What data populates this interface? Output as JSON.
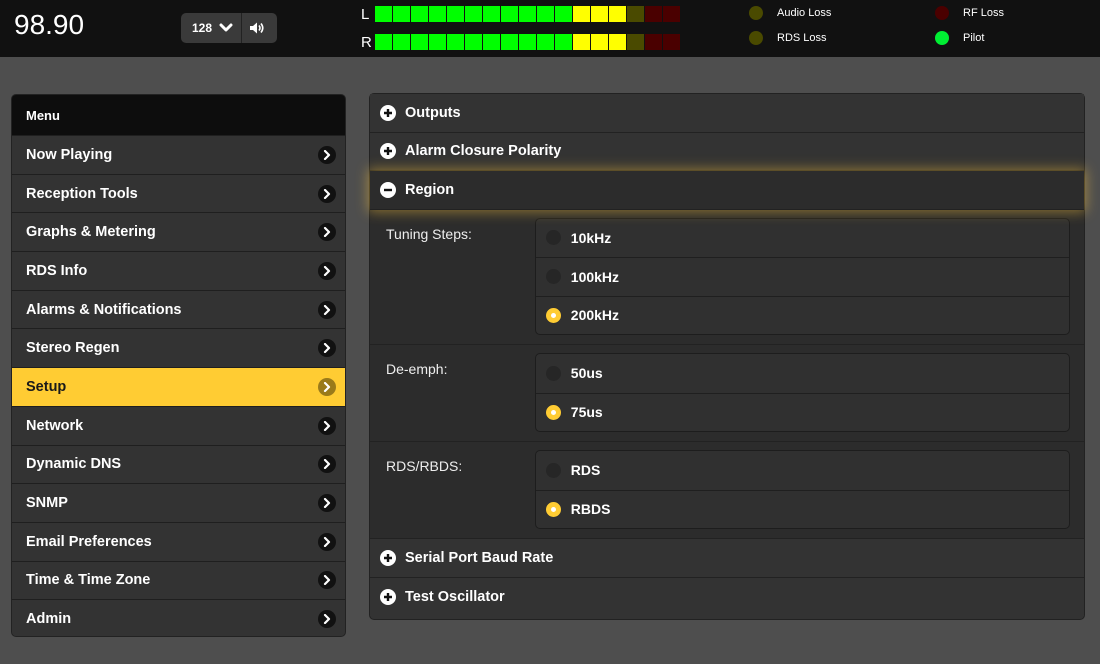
{
  "header": {
    "frequency": "98.90",
    "volume_value": "128"
  },
  "meters": {
    "left": {
      "label": "L",
      "level": 0.625,
      "segments": [
        "#00ff00",
        "#00ff00",
        "#00ff00",
        "#00ff00",
        "#00ff00",
        "#00ff00",
        "#00ff00",
        "#00ff00",
        "#00ff00",
        "#00ff00",
        "#00ff00",
        "#ffff00",
        "#ffff00",
        "#ffff00",
        "#4a4a00",
        "#4a0000",
        "#4a0000"
      ]
    },
    "right": {
      "label": "R",
      "level": 0.625,
      "segments": [
        "#00ff00",
        "#00ff00",
        "#00ff00",
        "#00ff00",
        "#00ff00",
        "#00ff00",
        "#00ff00",
        "#00ff00",
        "#00ff00",
        "#00ff00",
        "#00ff00",
        "#ffff00",
        "#ffff00",
        "#ffff00",
        "#4a4a00",
        "#4a0000",
        "#4a0000"
      ]
    }
  },
  "indicators": {
    "audio_loss": {
      "label": "Audio Loss",
      "color": "#4a4a00"
    },
    "rds_loss": {
      "label": "RDS Loss",
      "color": "#4a4a00"
    },
    "rf_loss": {
      "label": "RF Loss",
      "color": "#4a0000"
    },
    "pilot": {
      "label": "Pilot",
      "color": "#00ee33"
    }
  },
  "sidebar": {
    "title": "Menu",
    "items": [
      {
        "label": "Now Playing"
      },
      {
        "label": "Reception Tools"
      },
      {
        "label": "Graphs & Metering"
      },
      {
        "label": "RDS Info"
      },
      {
        "label": "Alarms & Notifications"
      },
      {
        "label": "Stereo Regen"
      },
      {
        "label": "Setup",
        "active": true
      },
      {
        "label": "Network"
      },
      {
        "label": "Dynamic DNS"
      },
      {
        "label": "SNMP"
      },
      {
        "label": "Email Preferences"
      },
      {
        "label": "Time & Time Zone"
      },
      {
        "label": "Admin"
      }
    ]
  },
  "main": {
    "sections": {
      "outputs": "Outputs",
      "alarm_closure_polarity": "Alarm Closure Polarity",
      "region": "Region",
      "serial_port_baud_rate": "Serial Port Baud Rate",
      "test_oscillator": "Test Oscillator"
    },
    "region": {
      "tuning_steps": {
        "label": "Tuning Steps:",
        "options": [
          "10kHz",
          "100kHz",
          "200kHz"
        ],
        "selected": "200kHz"
      },
      "de_emph": {
        "label": "De-emph:",
        "options": [
          "50us",
          "75us"
        ],
        "selected": "75us"
      },
      "rds_rbds": {
        "label": "RDS/RBDS:",
        "options": [
          "RDS",
          "RBDS"
        ],
        "selected": "RBDS"
      }
    }
  },
  "colors": {
    "accent": "#ffcc33",
    "background": "#4e4e4e",
    "topbar": "#111111"
  }
}
